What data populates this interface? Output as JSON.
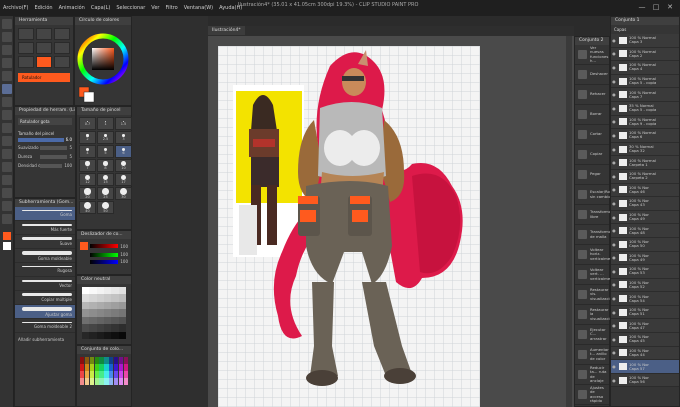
{
  "window": {
    "title": "Ilustración4* (35.01 x 41.05cm 300dpi 19.3%) - CLIP STUDIO PAINT PRO",
    "min": "—",
    "max": "□",
    "close": "✕"
  },
  "menu": [
    "Archivo(F)",
    "Edición",
    "Animación",
    "Capa(L)",
    "Seleccionar",
    "Ver",
    "Filtro",
    "Ventana(W)",
    "Ayuda(H)"
  ],
  "colors": {
    "main": "#ff5a1e",
    "sub": "#ffffff",
    "accent": "#ff5a1e",
    "selected_layer": "#4b5f86"
  },
  "subtool": {
    "header": "Herramienta",
    "active": "Rotulador"
  },
  "color_wheel": {
    "tab": "Círculo de colores"
  },
  "canvas_tab": {
    "label": "Ilustración4*"
  },
  "tool_property": {
    "header": "Propiedad de herram. (Li...",
    "brush_name": "Rotulador gota",
    "size_label": "Tamaño del pincel",
    "size_value": "6.0",
    "smooth_label": "Suavizado",
    "smooth_value": "5",
    "density_label": "Dureza",
    "density_value": "5",
    "pen_label": "Densidad del pincel",
    "pen_value": "100"
  },
  "brush_size": {
    "header": "Tamaño de pincel",
    "values": [
      "0.7",
      "1",
      "1.5",
      "2",
      "2.5",
      "3",
      "4",
      "5",
      "6",
      "7",
      "8",
      "10",
      "12",
      "15",
      "17",
      "20",
      "25",
      "30",
      "40",
      "50"
    ]
  },
  "subtools_list": {
    "header": "Subherramienta (Gom...",
    "items": [
      "Goma",
      "Más fuerte",
      "Suave",
      "Goma moldeable",
      "Rugosa",
      "Vector",
      "Copiar múltiple",
      "Ajustar goma",
      "Goma moldeable 2"
    ],
    "add": "Añadir subherramienta"
  },
  "color_slider": {
    "header": "Deslizador de co...",
    "values": [
      "100",
      "100",
      "100"
    ]
  },
  "color_set": {
    "header": "Color neutral"
  },
  "color_history": {
    "header": "Conjunto de colo..."
  },
  "commands": {
    "header": "Conjunto 2",
    "items": [
      "Ver nuevas funciones h...",
      "Deshacer",
      "Rehacer",
      "Borrar",
      "Cortar",
      "Copiar",
      "Pegar",
      "Escalar/Rotar sin cambio",
      "Transformación libre",
      "Transformación de malla",
      "Voltear horiz. verticalmente",
      "Voltear vert. ... verticalmente",
      "Restaurar vis. visualización",
      "Restaurar la visualización",
      "Ejecutar C... arrastrar",
      "Aumentar t... anillo de color",
      "Reducir ta... ruta de anclaje",
      "Ajustes de acceso rápido"
    ]
  },
  "layers": {
    "header": "Conjunto 1",
    "top_label": "Capas",
    "rows": [
      {
        "name": "100 % Normal",
        "sub": "Capa 3"
      },
      {
        "name": "100 % Normal",
        "sub": "Capa 2"
      },
      {
        "name": "100 % Normal",
        "sub": "Capa 4"
      },
      {
        "name": "100 % Normal",
        "sub": "Capa 5 - copia"
      },
      {
        "name": "100 % Normal",
        "sub": "Capa 7"
      },
      {
        "name": "35 % Normal",
        "sub": "Capa 5 - copia"
      },
      {
        "name": "100 % Normal",
        "sub": "Capa 9 - copia"
      },
      {
        "name": "100 % Normal",
        "sub": "Capa 6"
      },
      {
        "name": "30 % Normal",
        "sub": "Capa 32"
      },
      {
        "name": "100 % Normal",
        "sub": "Carpeta 1"
      },
      {
        "name": "100 % Normal",
        "sub": "Carpeta 2"
      },
      {
        "name": "100 % Nor",
        "sub": "Capa 46"
      },
      {
        "name": "100 % Nor",
        "sub": "Capa 43"
      },
      {
        "name": "100 % Nor",
        "sub": "Capa 49"
      },
      {
        "name": "100 % Nor",
        "sub": "Capa 48"
      },
      {
        "name": "100 % Nor",
        "sub": "Capa 50"
      },
      {
        "name": "100 % Nor",
        "sub": "Capa 49"
      },
      {
        "name": "100 % Nor",
        "sub": "Capa 53"
      },
      {
        "name": "100 % Nor",
        "sub": "Capa 52"
      },
      {
        "name": "100 % Nor",
        "sub": "Capa 54"
      },
      {
        "name": "100 % Nor",
        "sub": "Capa 51"
      },
      {
        "name": "100 % Nor",
        "sub": "Capa 47"
      },
      {
        "name": "100 % Nor",
        "sub": "Capa 45"
      },
      {
        "name": "100 % Nor",
        "sub": "Capa 44"
      },
      {
        "name": "100 % Nor",
        "sub": "Capa 57"
      },
      {
        "name": "100 % Nor",
        "sub": "Capa 56"
      }
    ]
  }
}
